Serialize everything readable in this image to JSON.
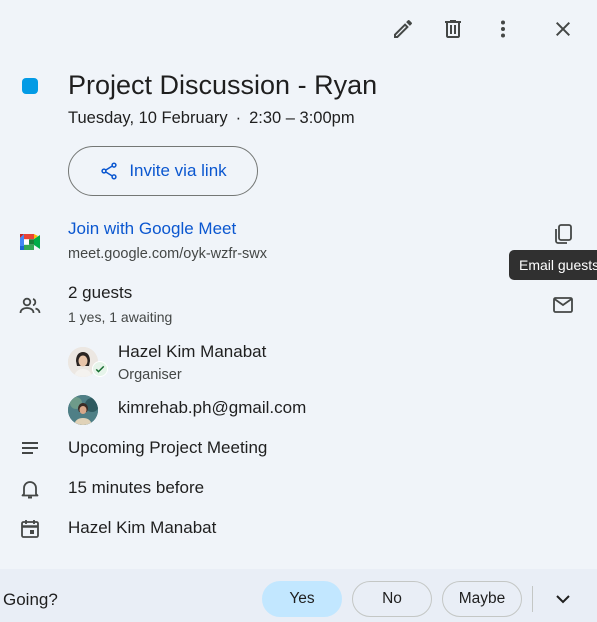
{
  "toolbar": {
    "edit_icon": "pencil-icon",
    "delete_icon": "trash-icon",
    "more_icon": "more-vert-icon",
    "close_icon": "close-icon"
  },
  "event": {
    "color": "#039be5",
    "title": "Project Discussion - Ryan",
    "date": "Tuesday, 10 February",
    "separator": "·",
    "time": "2:30 – 3:00pm"
  },
  "invite": {
    "label": "Invite via link"
  },
  "meet": {
    "join_label": "Join with Google Meet",
    "url": "meet.google.com/oyk-wzfr-swx"
  },
  "tooltip": {
    "text": "Email guests"
  },
  "guests": {
    "title": "2 guests",
    "summary": "1 yes, 1 awaiting",
    "list": [
      {
        "name": "Hazel Kim Manabat",
        "role": "Organiser"
      },
      {
        "name": "kimrehab.ph@gmail.com",
        "role": ""
      }
    ]
  },
  "description": "Upcoming Project Meeting",
  "reminder": "15 minutes before",
  "calendar_owner": "Hazel Kim Manabat",
  "rsvp": {
    "question": "Going?",
    "options": [
      "Yes",
      "No",
      "Maybe"
    ],
    "selected": "Yes"
  },
  "colors": {
    "accent": "#0b57d0",
    "selected_rsvp": "#c2e7ff",
    "footer_bg": "#e9eef6"
  }
}
